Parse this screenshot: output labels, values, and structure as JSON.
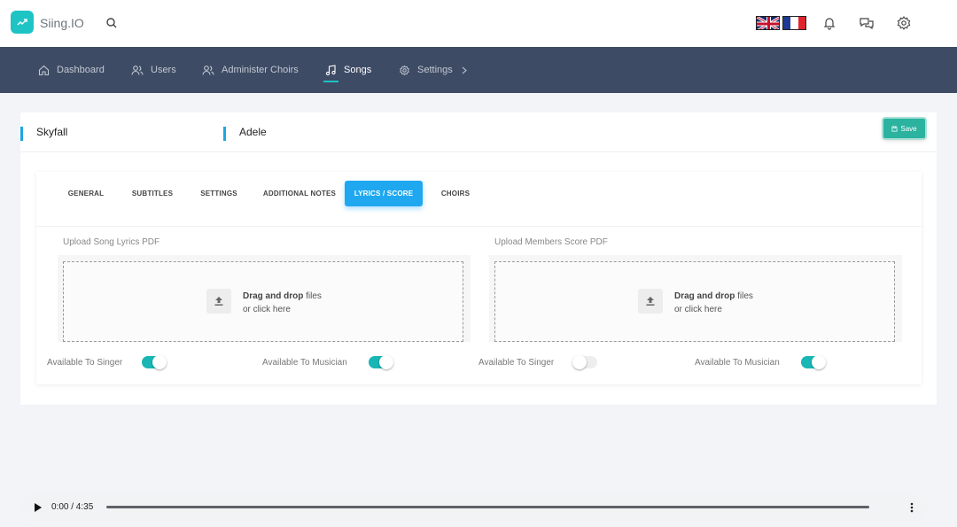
{
  "app": {
    "name": "Siing.IO"
  },
  "nav": {
    "items": [
      {
        "label": "Dashboard",
        "icon": "home-icon"
      },
      {
        "label": "Users",
        "icon": "users-icon"
      },
      {
        "label": "Administer Choirs",
        "icon": "users-icon"
      },
      {
        "label": "Songs",
        "icon": "music-note-icon",
        "active": true
      },
      {
        "label": "Settings",
        "icon": "gear-icon"
      }
    ]
  },
  "song": {
    "title": "Skyfall",
    "artist": "Adele"
  },
  "toolbar": {
    "save_label": "Save"
  },
  "tabs": [
    {
      "label": "GENERAL"
    },
    {
      "label": "SUBTITLES"
    },
    {
      "label": "SETTINGS"
    },
    {
      "label": "ADDITIONAL NOTES"
    },
    {
      "label": "LYRICS / SCORE",
      "active": true
    },
    {
      "label": "CHOIRS"
    }
  ],
  "uploads": {
    "lyrics": {
      "label": "Upload Song Lyrics PDF",
      "drag_bold": "Drag and drop",
      "drag_rest": " files",
      "click_text": "or click here"
    },
    "score": {
      "label": "Upload Members Score PDF",
      "drag_bold": "Drag and drop",
      "drag_rest": " files",
      "click_text": "or click here"
    }
  },
  "toggles": [
    {
      "label": "Available To Singer",
      "on": true
    },
    {
      "label": "Available To Musician",
      "on": true
    },
    {
      "label": "Available To Singer",
      "on": false
    },
    {
      "label": "Available To Musician",
      "on": true
    }
  ],
  "player": {
    "time": "0:00 / 4:35"
  },
  "colors": {
    "accent": "#1ec4c4",
    "nav_bg": "#3e4b64",
    "tab_active": "#1fa8f0",
    "save": "#2bb3a0"
  }
}
